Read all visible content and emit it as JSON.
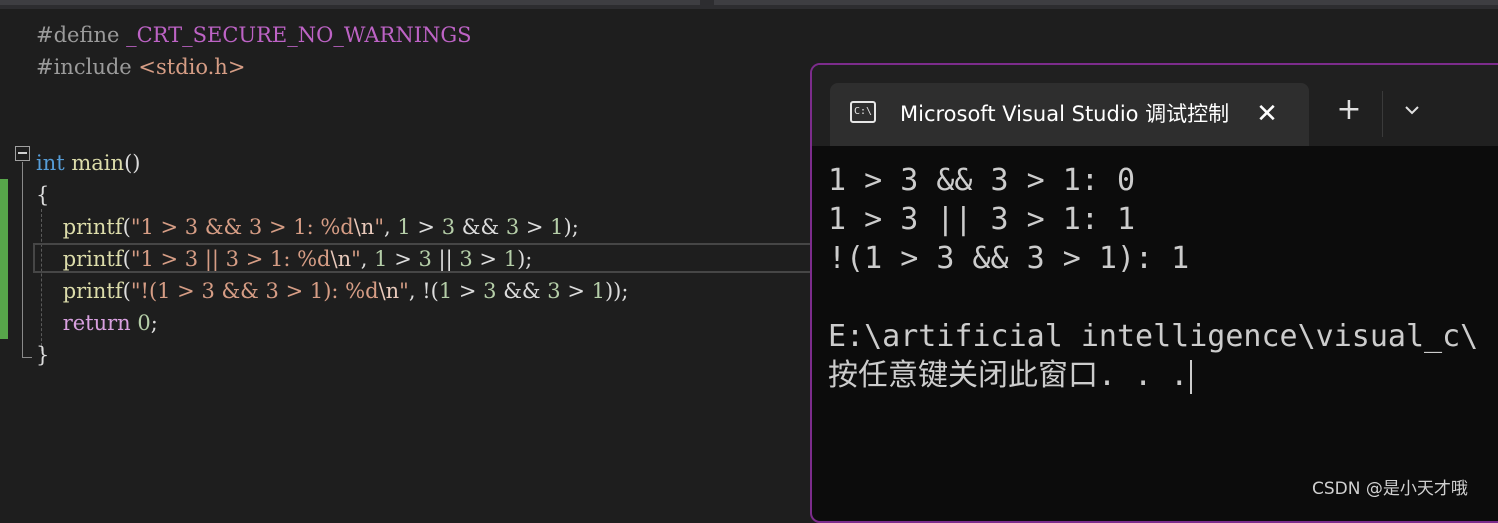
{
  "editor": {
    "lines": [
      [
        {
          "c": "pp",
          "t": "#define "
        },
        {
          "c": "macro",
          "t": "_CRT_SECURE_NO_WARNINGS"
        }
      ],
      [
        {
          "c": "pp",
          "t": "#include "
        },
        {
          "c": "str",
          "t": "<stdio.h>"
        }
      ],
      [],
      [],
      [
        {
          "c": "kw",
          "t": "int"
        },
        {
          "c": "pl",
          "t": " "
        },
        {
          "c": "fn",
          "t": "main"
        },
        {
          "c": "pl",
          "t": "()"
        }
      ],
      [
        {
          "c": "pl",
          "t": "{"
        }
      ],
      [
        {
          "c": "pl",
          "t": "    "
        },
        {
          "c": "fn",
          "t": "printf"
        },
        {
          "c": "pl",
          "t": "("
        },
        {
          "c": "str",
          "t": "\"1 > 3 && 3 > 1: %d"
        },
        {
          "c": "esc",
          "t": "\\n"
        },
        {
          "c": "str",
          "t": "\""
        },
        {
          "c": "pl",
          "t": ", "
        },
        {
          "c": "num",
          "t": "1"
        },
        {
          "c": "pl",
          "t": " > "
        },
        {
          "c": "num",
          "t": "3"
        },
        {
          "c": "pl",
          "t": " && "
        },
        {
          "c": "num",
          "t": "3"
        },
        {
          "c": "pl",
          "t": " > "
        },
        {
          "c": "num",
          "t": "1"
        },
        {
          "c": "pl",
          "t": ");"
        }
      ],
      [
        {
          "c": "pl",
          "t": "    "
        },
        {
          "c": "fn",
          "t": "printf"
        },
        {
          "c": "pl",
          "t": "("
        },
        {
          "c": "str",
          "t": "\"1 > 3 || 3 > 1: %d"
        },
        {
          "c": "esc",
          "t": "\\n"
        },
        {
          "c": "str",
          "t": "\""
        },
        {
          "c": "pl",
          "t": ", "
        },
        {
          "c": "num",
          "t": "1"
        },
        {
          "c": "pl",
          "t": " > "
        },
        {
          "c": "num",
          "t": "3"
        },
        {
          "c": "pl",
          "t": " || "
        },
        {
          "c": "num",
          "t": "3"
        },
        {
          "c": "pl",
          "t": " > "
        },
        {
          "c": "num",
          "t": "1"
        },
        {
          "c": "pl",
          "t": ");"
        }
      ],
      [
        {
          "c": "pl",
          "t": "    "
        },
        {
          "c": "fn",
          "t": "printf"
        },
        {
          "c": "pl",
          "t": "("
        },
        {
          "c": "str",
          "t": "\"!(1 > 3 && 3 > 1): %d"
        },
        {
          "c": "esc",
          "t": "\\n"
        },
        {
          "c": "str",
          "t": "\""
        },
        {
          "c": "pl",
          "t": ", !("
        },
        {
          "c": "num",
          "t": "1"
        },
        {
          "c": "pl",
          "t": " > "
        },
        {
          "c": "num",
          "t": "3"
        },
        {
          "c": "pl",
          "t": " && "
        },
        {
          "c": "num",
          "t": "3"
        },
        {
          "c": "pl",
          "t": " > "
        },
        {
          "c": "num",
          "t": "1"
        },
        {
          "c": "pl",
          "t": "));"
        }
      ],
      [
        {
          "c": "pl",
          "t": "    "
        },
        {
          "c": "ret",
          "t": "return"
        },
        {
          "c": "pl",
          "t": " "
        },
        {
          "c": "num",
          "t": "0"
        },
        {
          "c": "pl",
          "t": ";"
        }
      ],
      [
        {
          "c": "pl",
          "t": "}"
        }
      ]
    ]
  },
  "console": {
    "tab_title": "Microsoft Visual Studio 调试控制台",
    "tab_icon_text": "C:\\",
    "close_glyph": "✕",
    "new_tab_glyph": "+",
    "lines": [
      "1 > 3 && 3 > 1: 0",
      "1 > 3 || 3 > 1: 1",
      "!(1 > 3 && 3 > 1): 1",
      "",
      "E:\\artificial intelligence\\visual_c\\",
      "按任意键关闭此窗口. . ."
    ]
  },
  "watermark": "CSDN @是小天才哦",
  "colors": {
    "editor_bg": "#1e1e1e",
    "console_bg": "#0c0c0c",
    "console_border": "#7c2c8c",
    "change_bar": "#57a64a"
  }
}
